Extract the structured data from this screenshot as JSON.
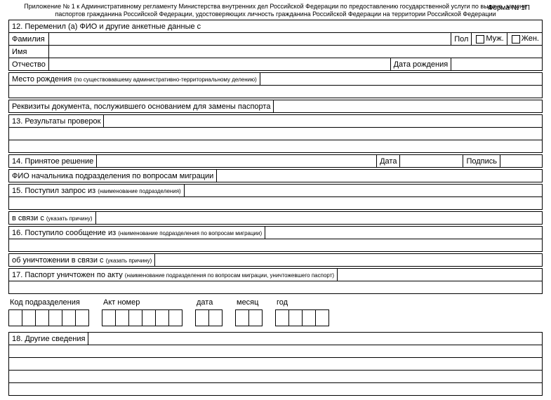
{
  "header": {
    "line1": "Приложение № 1 к Административному регламенту Министерства внутренних дел Российской Федерации по предоставлению государственной услуги по выдаче, замене",
    "line2": "паспортов гражданина Российской Федерации, удостоверяющих личность гражданина Российской Федерации на территории Российской Федерации",
    "form_no": "Форма № 1П"
  },
  "s12": {
    "title": "12. Переменил (а) ФИО и другие анкетные данные с",
    "surname": "Фамилия",
    "sex": "Пол",
    "male": "Муж.",
    "female": "Жен.",
    "name": "Имя",
    "patronymic": "Отчество",
    "dob": "Дата рождения",
    "pob": "Место рождения",
    "pob_sub": "(по существовавшему административно-территориальному делению)",
    "doc": "Реквизиты документа, послужившего основанием для замены паспорта"
  },
  "s13": {
    "title": "13. Результаты проверок"
  },
  "s14": {
    "title": "14. Принятое решение",
    "date": "Дата",
    "signature": "Подпись",
    "fio_head": "ФИО начальника подразделения по вопросам миграции"
  },
  "s15": {
    "title": "15. Поступил запрос из",
    "title_sub": "(наименование подразделения)",
    "reason": "в связи с",
    "reason_sub": "(указать причину)"
  },
  "s16": {
    "title": "16. Поступило сообщение из",
    "title_sub": "(наименование подразделения по вопросам миграции)",
    "destroy": "об уничтожении в связи с",
    "destroy_sub": "(указать причину)"
  },
  "s17": {
    "title": "17. Паспорт уничтожен по акту",
    "title_sub": "(наименование подразделения по вопросам миграции, уничтожевшего паспорт)"
  },
  "boxes": {
    "dept_code": "Код подразделения",
    "act_no": "Акт номер",
    "date": "дата",
    "month": "месяц",
    "year": "год"
  },
  "s18": {
    "title": "18. Другие сведения"
  }
}
